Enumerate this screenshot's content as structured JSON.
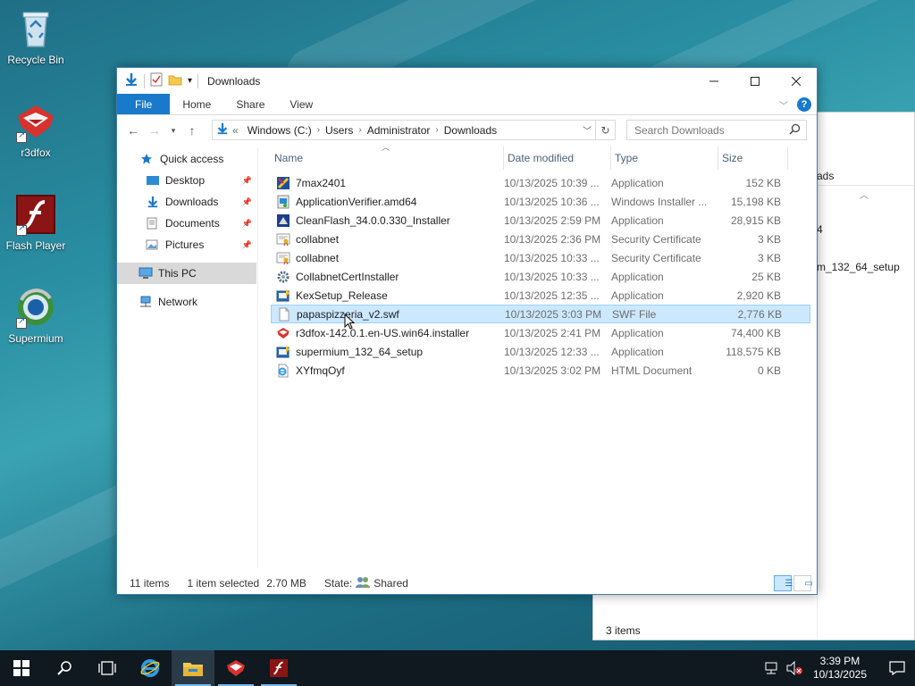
{
  "desktop": {
    "icons": [
      {
        "label": "Recycle Bin"
      },
      {
        "label": "r3dfox"
      },
      {
        "label": "Flash Player"
      },
      {
        "label": "Supermium"
      }
    ],
    "background_window": {
      "partial_text_1": "ads",
      "partial_text_2": "4",
      "partial_text_3": "m_132_64_setup",
      "status": "3 items"
    }
  },
  "window": {
    "title": "Downloads",
    "ribbon_tabs": [
      "File",
      "Home",
      "Share",
      "View"
    ],
    "address": {
      "overflow": "«",
      "crumbs": [
        "Windows (C:)",
        "Users",
        "Administrator",
        "Downloads"
      ]
    },
    "search_placeholder": "Search Downloads",
    "sidebar": [
      {
        "label": "Quick access"
      },
      {
        "label": "Desktop"
      },
      {
        "label": "Downloads"
      },
      {
        "label": "Documents"
      },
      {
        "label": "Pictures"
      },
      {
        "label": "This PC"
      },
      {
        "label": "Network"
      }
    ],
    "columns": [
      "Name",
      "Date modified",
      "Type",
      "Size"
    ],
    "files": [
      {
        "name": "7max2401",
        "date": "10/13/2025 10:39 ...",
        "type": "Application",
        "size": "152 KB",
        "icon": "app-7max-icon"
      },
      {
        "name": "ApplicationVerifier.amd64",
        "date": "10/13/2025 10:36 ...",
        "type": "Windows Installer ...",
        "size": "15,198 KB",
        "icon": "installer-icon"
      },
      {
        "name": "CleanFlash_34.0.0.330_Installer",
        "date": "10/13/2025 2:59 PM",
        "type": "Application",
        "size": "28,915 KB",
        "icon": "flash-installer-icon"
      },
      {
        "name": "collabnet",
        "date": "10/13/2025 2:36 PM",
        "type": "Security Certificate",
        "size": "3 KB",
        "icon": "certificate-icon"
      },
      {
        "name": "collabnet",
        "date": "10/13/2025 10:33 ...",
        "type": "Security Certificate",
        "size": "3 KB",
        "icon": "certificate-icon"
      },
      {
        "name": "CollabnetCertInstaller",
        "date": "10/13/2025 10:33 ...",
        "type": "Application",
        "size": "25 KB",
        "icon": "gear-app-icon"
      },
      {
        "name": "KexSetup_Release",
        "date": "10/13/2025 12:35 ...",
        "type": "Application",
        "size": "2,920 KB",
        "icon": "setup-icon"
      },
      {
        "name": "papaspizzeria_v2.swf",
        "date": "10/13/2025 3:03 PM",
        "type": "SWF File",
        "size": "2,776 KB",
        "icon": "blank-file-icon"
      },
      {
        "name": "r3dfox-142.0.1.en-US.win64.installer",
        "date": "10/13/2025 2:41 PM",
        "type": "Application",
        "size": "74,400 KB",
        "icon": "r3dfox-icon"
      },
      {
        "name": "supermium_132_64_setup",
        "date": "10/13/2025 12:33 ...",
        "type": "Application",
        "size": "118,575 KB",
        "icon": "setup-icon"
      },
      {
        "name": "XYfmqOyf",
        "date": "10/13/2025 3:02 PM",
        "type": "HTML Document",
        "size": "0 KB",
        "icon": "html-doc-icon"
      }
    ],
    "selected_index": 7,
    "status": {
      "count": "11 items",
      "selection": "1 item selected",
      "size": "2.70 MB",
      "state_label": "State:",
      "state_value": "Shared"
    }
  },
  "taskbar": {
    "time": "3:39 PM",
    "date": "10/13/2025"
  }
}
